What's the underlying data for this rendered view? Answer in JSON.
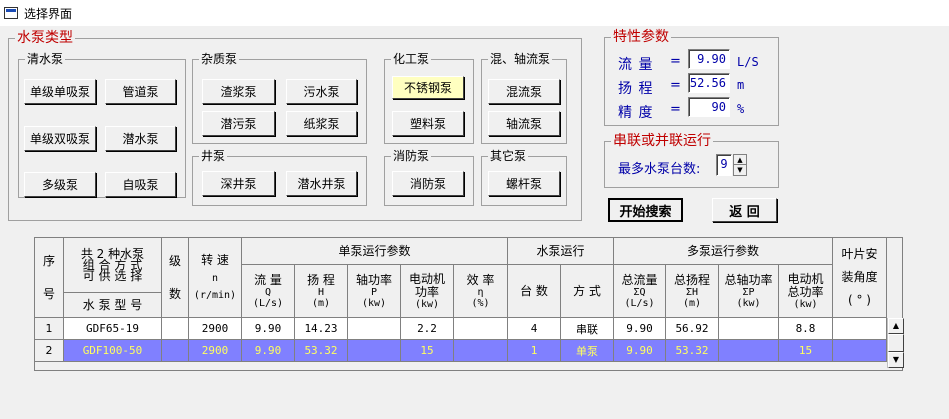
{
  "window": {
    "title": "选择界面"
  },
  "pump_types": {
    "legend": "水泵类型",
    "clean": {
      "legend": "清水泵",
      "buttons": [
        "单级单吸泵",
        "管道泵",
        "单级双吸泵",
        "潜水泵",
        "多级泵",
        "自吸泵"
      ]
    },
    "impurity": {
      "legend": "杂质泵",
      "buttons": [
        "渣浆泵",
        "污水泵",
        "潜污泵",
        "纸浆泵"
      ]
    },
    "chemical": {
      "legend": "化工泵",
      "buttons": [
        "不锈钢泵",
        "塑料泵"
      ],
      "selected": "不锈钢泵"
    },
    "mixed": {
      "legend": "混、轴流泵",
      "buttons": [
        "混流泵",
        "轴流泵"
      ]
    },
    "well": {
      "legend": "井泵",
      "buttons": [
        "深井泵",
        "潜水井泵"
      ]
    },
    "fire": {
      "legend": "消防泵",
      "buttons": [
        "消防泵"
      ]
    },
    "other": {
      "legend": "其它泵",
      "buttons": [
        "螺杆泵"
      ]
    }
  },
  "params": {
    "legend": "特性参数",
    "flow": {
      "label": "流  量",
      "value": "9.90",
      "unit": "L/S"
    },
    "head": {
      "label": "扬  程",
      "value": "52.56",
      "unit": "m"
    },
    "accuracy": {
      "label": "精  度",
      "value": "90",
      "unit": "%"
    },
    "eq": "="
  },
  "series": {
    "legend": "串联或并联运行",
    "label": "最多水泵台数:",
    "value": "9"
  },
  "actions": {
    "search": "开始搜索",
    "back": "返  回"
  },
  "table": {
    "h_seq": [
      "序",
      "号"
    ],
    "h_combo": [
      "共 2 种水泵",
      "组 合 方 式",
      "可 供 选 择"
    ],
    "h_model": "水 泵 型 号",
    "h_stage": [
      "级",
      "数"
    ],
    "h_speed": [
      "转  速",
      "n",
      "(r/min)"
    ],
    "h_single": "单泵运行参数",
    "h_s_flow": [
      "流  量",
      "Q",
      "(L/s)"
    ],
    "h_s_head": [
      "扬  程",
      "H",
      "(m)"
    ],
    "h_s_shaft": [
      "轴功率",
      "P",
      "(kw)"
    ],
    "h_s_motor": [
      "电动机",
      "功率",
      "(kw)"
    ],
    "h_s_eff": [
      "效  率",
      "η",
      "(%)"
    ],
    "h_run": "水泵运行",
    "h_run_count": "台  数",
    "h_run_mode": "方  式",
    "h_multi": "多泵运行参数",
    "h_m_flow": [
      "总流量",
      "ΣQ",
      "(L/s)"
    ],
    "h_m_head": [
      "总扬程",
      "ΣH",
      "(m)"
    ],
    "h_m_shaft": [
      "总轴功率",
      "ΣP",
      "(kw)"
    ],
    "h_m_motor": [
      "电动机",
      "总功率",
      "(kw)"
    ],
    "h_angle": [
      "叶片安",
      "装角度",
      "( ° )"
    ],
    "rows": [
      {
        "idx": "1",
        "model": "GDF65-19",
        "stage": "",
        "speed": "2900",
        "flow": "9.90",
        "head": "14.23",
        "shaft": "",
        "motor": "2.2",
        "eff": "",
        "count": "4",
        "mode": "串联",
        "tflow": "9.90",
        "thead": "56.92",
        "tshaft": "",
        "tmotor": "8.8",
        "angle": ""
      },
      {
        "idx": "2",
        "model": "GDF100-50",
        "stage": "",
        "speed": "2900",
        "flow": "9.90",
        "head": "53.32",
        "shaft": "",
        "motor": "15",
        "eff": "",
        "count": "1",
        "mode": "单泵",
        "tflow": "9.90",
        "thead": "53.32",
        "tshaft": "",
        "tmotor": "15",
        "angle": ""
      }
    ]
  },
  "colors": {
    "selected_row_bg": "#8080ff",
    "selected_row_text": "#ffff60",
    "selected_button_bg": "#ffffc0",
    "legend_red": "#c00000",
    "value_blue": "#0000a8"
  }
}
